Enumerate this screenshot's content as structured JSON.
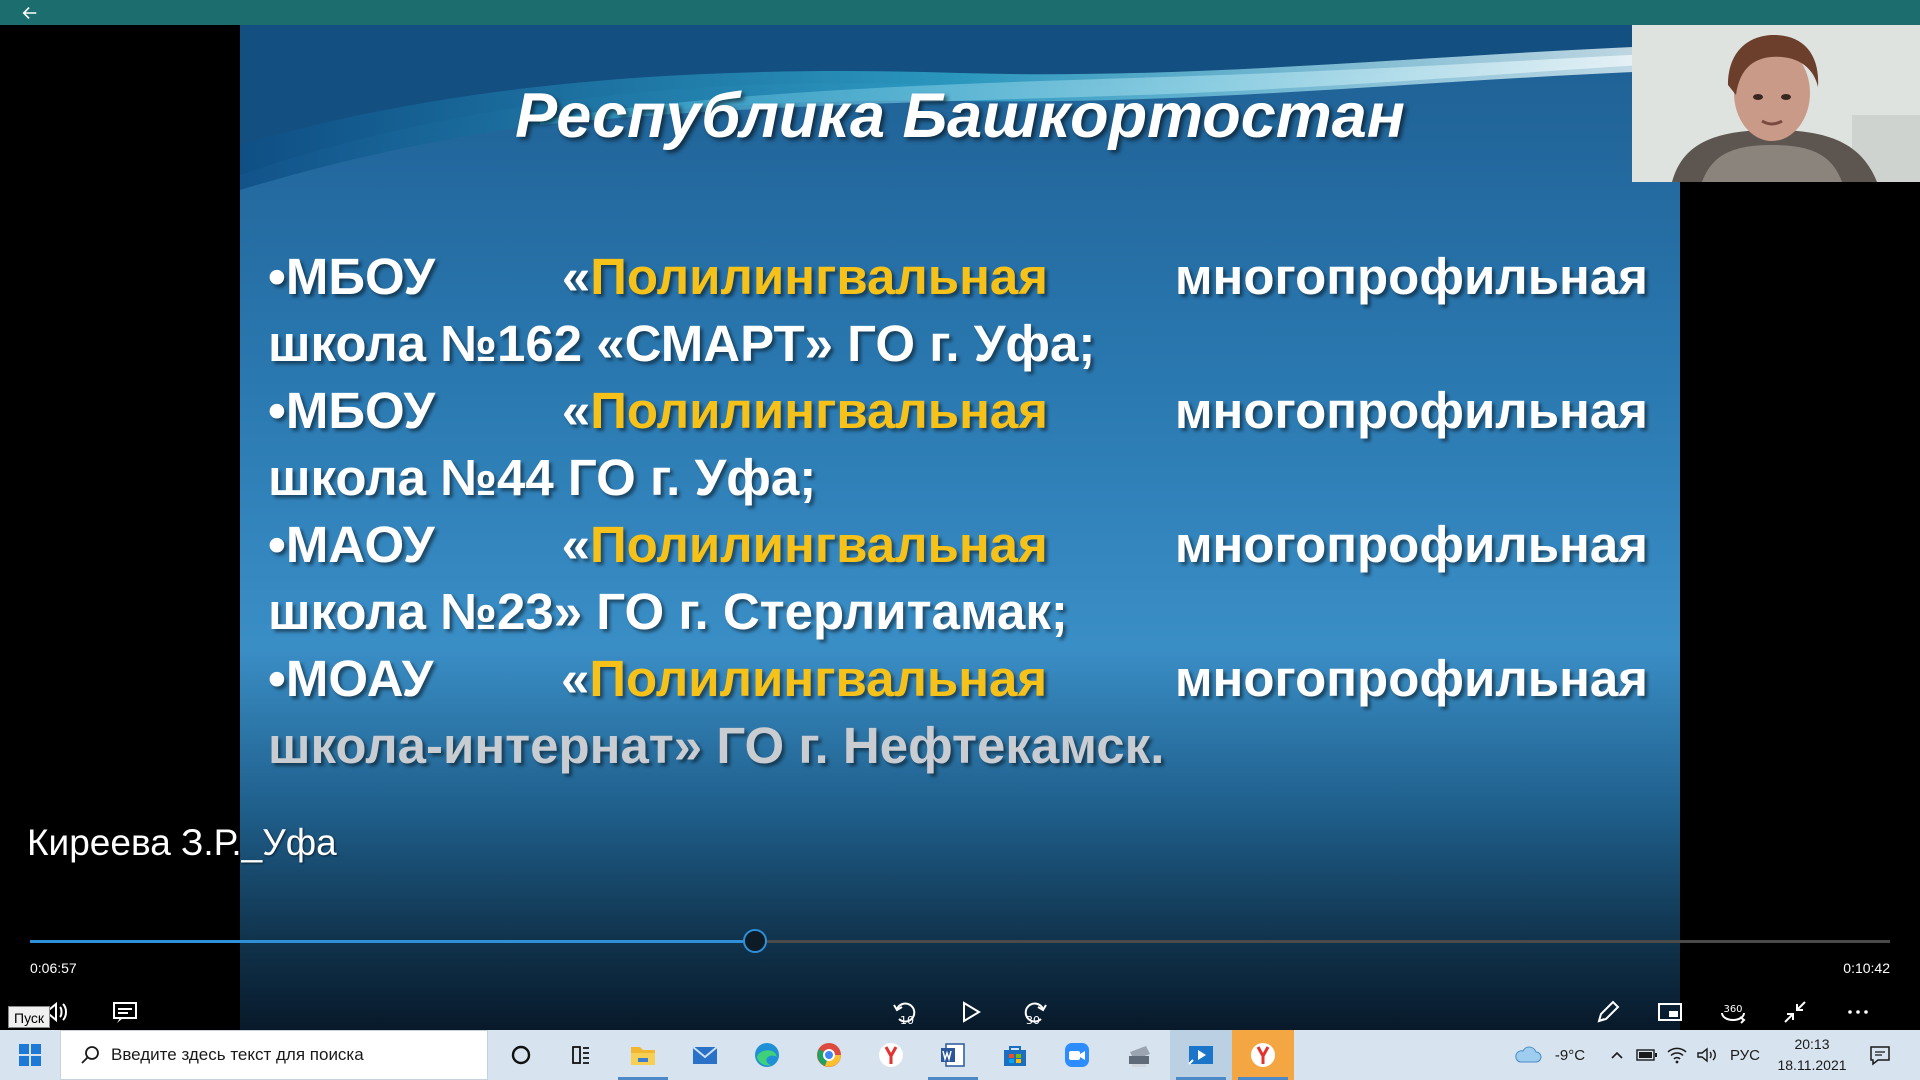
{
  "topbar": {
    "back_icon": "arrow-left-icon"
  },
  "slide": {
    "title": "Республика Башкортостан",
    "items": [
      {
        "prefix": "•МБОУ",
        "quote": "«",
        "highlight": "Полилингвальная",
        "tail": "многопрофильная",
        "line2": "школа №162 «СМАРТ» ГО г. Уфа;"
      },
      {
        "prefix": "•МБОУ",
        "quote": "«",
        "highlight": "Полилингвальная",
        "tail": "многопрофильная",
        "line2": "школа №44 ГО г. Уфа;"
      },
      {
        "prefix": "•МАОУ",
        "quote": "«",
        "highlight": "Полилингвальная",
        "tail": "многопрофильная",
        "line2": "школа №23» ГО г. Стерлитамак;"
      },
      {
        "prefix": "•МОАУ",
        "quote": "«",
        "highlight": "Полилингвальная",
        "tail": "многопрофильная",
        "line2": "школа-интернат» ГО г. Нефтекамск."
      }
    ],
    "colors": {
      "highlight": "#f6c21a",
      "text": "#ffffff"
    }
  },
  "player": {
    "speaker": "Киреева З.Р._Уфа",
    "time_elapsed": "0:06:57",
    "time_total": "0:10:42",
    "progress_fraction": 0.39,
    "start_tooltip": "Пуск",
    "skip_back_label": "10",
    "skip_forward_label": "30",
    "controls_right": [
      "pen-icon",
      "mini-view-icon",
      "360-icon",
      "shrink-icon",
      "more-icon"
    ],
    "label_360": "360"
  },
  "taskbar": {
    "search_placeholder": "Введите здесь текст для поиска",
    "weather": "-9°C",
    "language": "РУС",
    "time": "20:13",
    "date": "18.11.2021",
    "apps": [
      "cortana-icon",
      "task-view-icon",
      "file-explorer-icon",
      "mail-icon",
      "edge-icon",
      "chrome-icon",
      "yandex-icon",
      "word-icon",
      "store-icon",
      "zoom-icon",
      "printer-app-icon",
      "movies-tv-icon",
      "yandex-browser-icon"
    ]
  }
}
